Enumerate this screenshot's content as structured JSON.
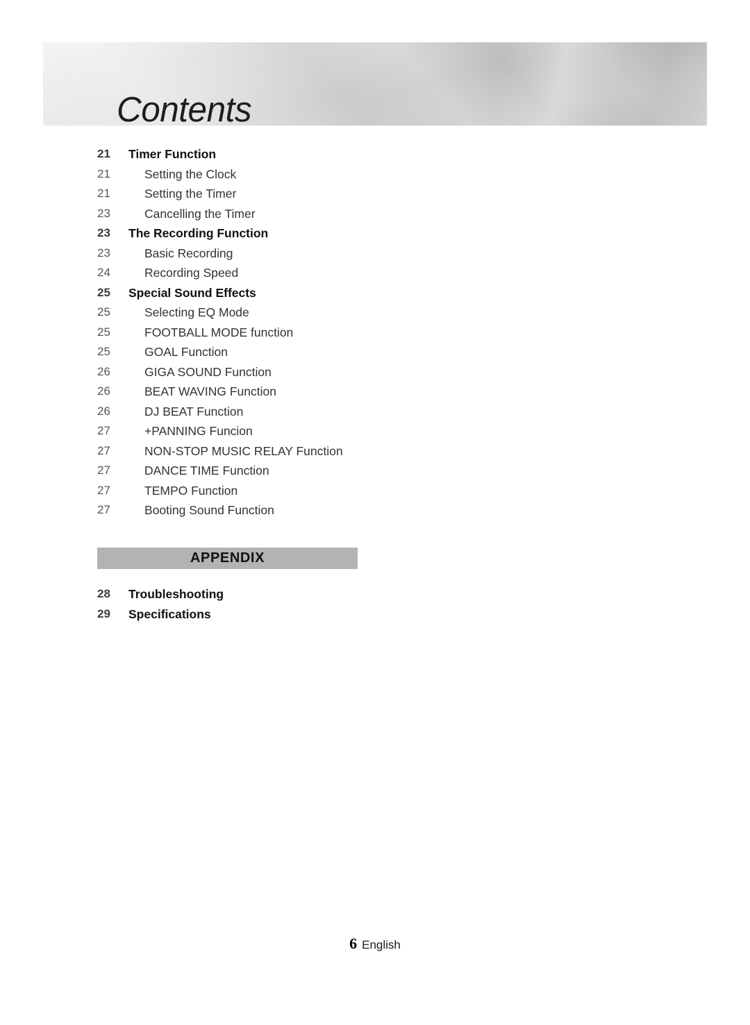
{
  "page": {
    "title": "Contents",
    "footer": {
      "page_number": "6",
      "language": "English"
    }
  },
  "toc": {
    "entries": [
      {
        "page": "21",
        "label": "Timer Function",
        "level": 1
      },
      {
        "page": "21",
        "label": "Setting the Clock",
        "level": 2
      },
      {
        "page": "21",
        "label": "Setting the Timer",
        "level": 2
      },
      {
        "page": "23",
        "label": "Cancelling the Timer",
        "level": 2
      },
      {
        "page": "23",
        "label": "The Recording Function",
        "level": 1
      },
      {
        "page": "23",
        "label": "Basic Recording",
        "level": 2
      },
      {
        "page": "24",
        "label": "Recording Speed",
        "level": 2
      },
      {
        "page": "25",
        "label": "Special Sound Effects",
        "level": 1
      },
      {
        "page": "25",
        "label": "Selecting EQ Mode",
        "level": 2
      },
      {
        "page": "25",
        "label": "FOOTBALL MODE function",
        "level": 2
      },
      {
        "page": "25",
        "label": "GOAL Function",
        "level": 2
      },
      {
        "page": "26",
        "label": "GIGA SOUND Function",
        "level": 2
      },
      {
        "page": "26",
        "label": "BEAT WAVING Function",
        "level": 2
      },
      {
        "page": "26",
        "label": "DJ BEAT Function",
        "level": 2
      },
      {
        "page": "27",
        "label": "+PANNING Funcion",
        "level": 2
      },
      {
        "page": "27",
        "label": "NON-STOP MUSIC RELAY Function",
        "level": 2
      },
      {
        "page": "27",
        "label": "DANCE TIME Function",
        "level": 2
      },
      {
        "page": "27",
        "label": "TEMPO Function",
        "level": 2
      },
      {
        "page": "27",
        "label": "Booting Sound Function",
        "level": 2
      }
    ]
  },
  "appendix": {
    "heading": "APPENDIX",
    "entries": [
      {
        "page": "28",
        "label": "Troubleshooting",
        "level": 1
      },
      {
        "page": "29",
        "label": "Specifications",
        "level": 1
      }
    ]
  },
  "colors": {
    "appendix_bar_background": "#b3b3b3",
    "page_number_text": "#555555",
    "heading_text": "#111111",
    "body_text": "#333333",
    "page_background": "#ffffff"
  }
}
